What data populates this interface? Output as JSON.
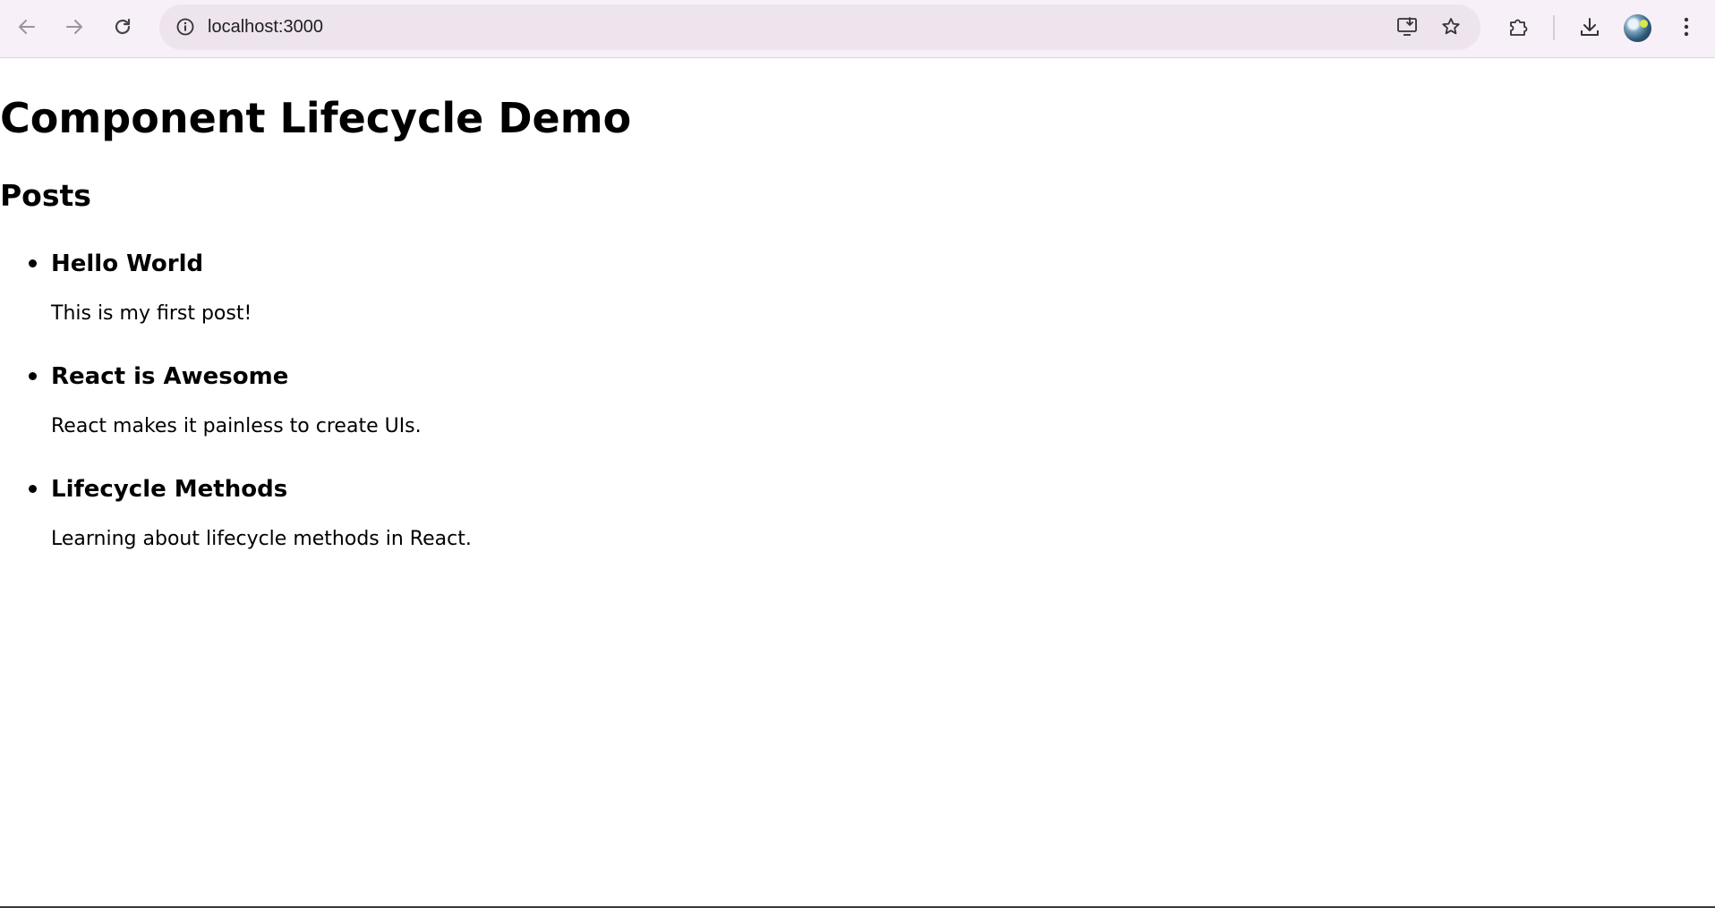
{
  "browser": {
    "url": "localhost:3000",
    "icons": {
      "back": "arrow-left-icon",
      "forward": "arrow-right-icon",
      "reload": "reload-icon",
      "site_info": "info-icon",
      "install": "install-app-icon",
      "bookmark": "star-icon",
      "extensions": "puzzle-icon",
      "downloads": "download-icon",
      "profile": "avatar",
      "menu": "kebab-menu-icon"
    }
  },
  "page": {
    "title": "Component Lifecycle Demo",
    "section_heading": "Posts",
    "posts": [
      {
        "title": "Hello World",
        "body": "This is my first post!"
      },
      {
        "title": "React is Awesome",
        "body": "React makes it painless to create UIs."
      },
      {
        "title": "Lifecycle Methods",
        "body": "Learning about lifecycle methods in React."
      }
    ]
  }
}
